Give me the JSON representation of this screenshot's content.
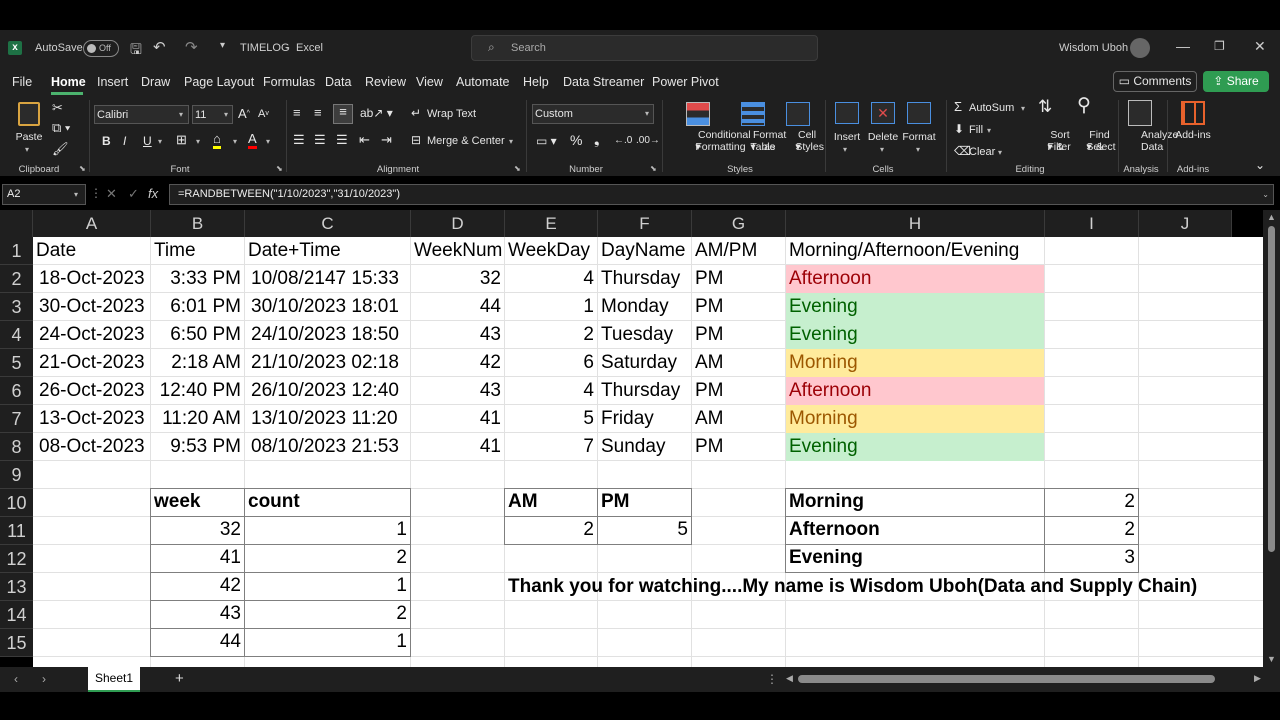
{
  "titlebar": {
    "autosave_label": "AutoSave",
    "autosave_state": "Off",
    "file_name": "TIMELOG",
    "app_name": "Excel",
    "search_placeholder": "Search",
    "user_name": "Wisdom Uboh"
  },
  "tabs": [
    "File",
    "Home",
    "Insert",
    "Draw",
    "Page Layout",
    "Formulas",
    "Data",
    "Review",
    "View",
    "Automate",
    "Help",
    "Data Streamer",
    "Power Pivot"
  ],
  "ribbon": {
    "comments_label": "Comments",
    "share_label": "Share",
    "clipboard": {
      "paste": "Paste",
      "group": "Clipboard"
    },
    "font": {
      "name": "Calibri",
      "size": "11",
      "group": "Font"
    },
    "alignment": {
      "wrap": "Wrap Text",
      "merge": "Merge & Center",
      "group": "Alignment"
    },
    "number": {
      "format": "Custom",
      "group": "Number"
    },
    "styles": {
      "conditional": "Conditional",
      "conditional2": "Formatting",
      "format_table": "Format as",
      "format_table2": "Table",
      "cell_styles": "Cell",
      "cell_styles2": "Styles",
      "group": "Styles"
    },
    "cells": {
      "insert": "Insert",
      "delete": "Delete",
      "format": "Format",
      "group": "Cells"
    },
    "editing": {
      "autosum": "AutoSum",
      "fill": "Fill",
      "clear": "Clear",
      "sort": "Sort &",
      "sort2": "Filter",
      "find": "Find &",
      "find2": "Select",
      "group": "Editing"
    },
    "analysis": {
      "analyze": "Analyze",
      "analyze2": "Data",
      "group": "Analysis"
    },
    "addins": {
      "label": "Add-ins",
      "group": "Add-ins"
    }
  },
  "formula_bar": {
    "name_box": "A2",
    "formula": "=RANDBETWEEN(\"1/10/2023\",\"31/10/2023\")"
  },
  "columns": [
    "A",
    "B",
    "C",
    "D",
    "E",
    "F",
    "G",
    "H",
    "I",
    "J"
  ],
  "rows": [
    "1",
    "2",
    "3",
    "4",
    "5",
    "6",
    "7",
    "8",
    "9",
    "10",
    "11",
    "12",
    "13",
    "14",
    "15"
  ],
  "headers": [
    "Date",
    "Time",
    "Date+Time",
    "WeekNum",
    "WeekDay",
    "DayName",
    "AM/PM",
    "Morning/Afternoon/Evening"
  ],
  "data_rows": [
    [
      "18-Oct-2023",
      "3:33 PM",
      "10/08/2147 15:33",
      "32",
      "4",
      "Thursday",
      "PM",
      "Afternoon"
    ],
    [
      "30-Oct-2023",
      "6:01 PM",
      "30/10/2023 18:01",
      "44",
      "1",
      "Monday",
      "PM",
      "Evening"
    ],
    [
      "24-Oct-2023",
      "6:50 PM",
      "24/10/2023 18:50",
      "43",
      "2",
      "Tuesday",
      "PM",
      "Evening"
    ],
    [
      "21-Oct-2023",
      "2:18 AM",
      "21/10/2023 02:18",
      "42",
      "6",
      "Saturday",
      "AM",
      "Morning"
    ],
    [
      "26-Oct-2023",
      "12:40 PM",
      "26/10/2023 12:40",
      "43",
      "4",
      "Thursday",
      "PM",
      "Afternoon"
    ],
    [
      "13-Oct-2023",
      "11:20 AM",
      "13/10/2023 11:20",
      "41",
      "5",
      "Friday",
      "AM",
      "Morning"
    ],
    [
      "08-Oct-2023",
      "9:53 PM",
      "08/10/2023 21:53",
      "41",
      "7",
      "Sunday",
      "PM",
      "Evening"
    ]
  ],
  "period_colors": {
    "Afternoon": {
      "bg": "#ffc7ce",
      "fg": "#9c0006"
    },
    "Evening": {
      "bg": "#c6efce",
      "fg": "#006100"
    },
    "Morning": {
      "bg": "#ffeb9c",
      "fg": "#9c5700"
    }
  },
  "week_table": {
    "header": [
      "week",
      "count"
    ],
    "rows": [
      [
        "32",
        "1"
      ],
      [
        "41",
        "2"
      ],
      [
        "42",
        "1"
      ],
      [
        "43",
        "2"
      ],
      [
        "44",
        "1"
      ]
    ]
  },
  "ampm_table": {
    "header": [
      "AM",
      "PM"
    ],
    "values": [
      "2",
      "5"
    ]
  },
  "period_table": {
    "rows": [
      [
        "Morning",
        "2"
      ],
      [
        "Afternoon",
        "2"
      ],
      [
        "Evening",
        "3"
      ]
    ]
  },
  "message": "Thank you for watching....My name is Wisdom Uboh(Data and Supply Chain)",
  "sheet_tab": "Sheet1"
}
